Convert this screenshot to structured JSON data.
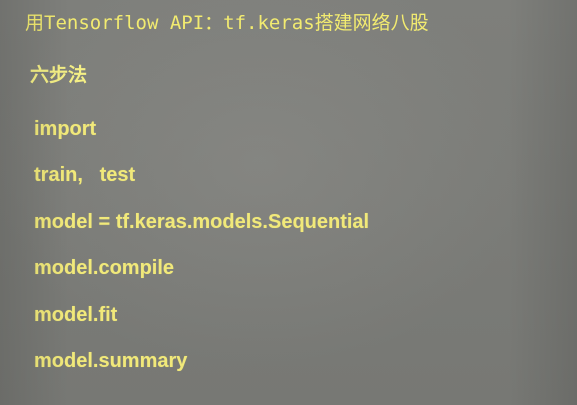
{
  "slide": {
    "title": "用Tensorflow API：tf.keras搭建网络八股",
    "subtitle": "六步法",
    "steps": [
      "import",
      "train,   test",
      "model = tf.keras.models.Sequential",
      "model.compile",
      "model.fit",
      "model.summary"
    ],
    "colors": {
      "background": "#7b7c78",
      "title_text": "#f2eb70",
      "step_text": "#f1e97a"
    }
  }
}
